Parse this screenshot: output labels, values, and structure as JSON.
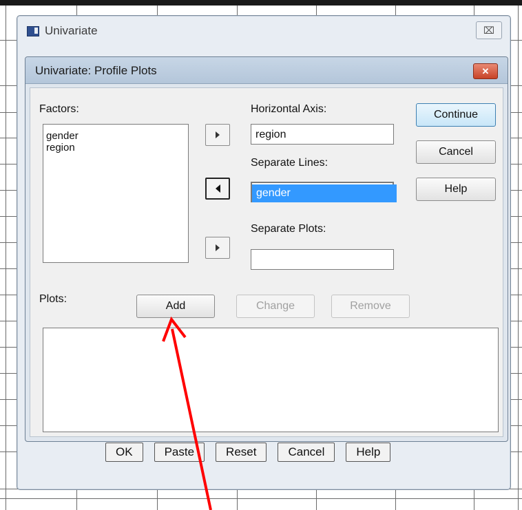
{
  "outer_dialog": {
    "title": "Univariate",
    "close_glyph": "⌧",
    "buttons": [
      "OK",
      "Paste",
      "Reset",
      "Cancel",
      "Help"
    ]
  },
  "dialog": {
    "title": "Univariate: Profile Plots",
    "close_glyph": "✕",
    "factors_label": "Factors:",
    "factors": [
      "gender",
      "region"
    ],
    "horizontal_axis_label": "Horizontal Axis:",
    "horizontal_axis_value": "region",
    "separate_lines_label": "Separate Lines:",
    "separate_lines_value": "gender",
    "separate_plots_label": "Separate Plots:",
    "separate_plots_value": "",
    "continue_label": "Continue",
    "cancel_label": "Cancel",
    "help_label": "Help",
    "plots_label": "Plots:",
    "add_label": "Add",
    "change_label": "Change",
    "remove_label": "Remove"
  },
  "colors": {
    "selection": "#3399ff",
    "annotation_arrow": "#ff0000"
  }
}
